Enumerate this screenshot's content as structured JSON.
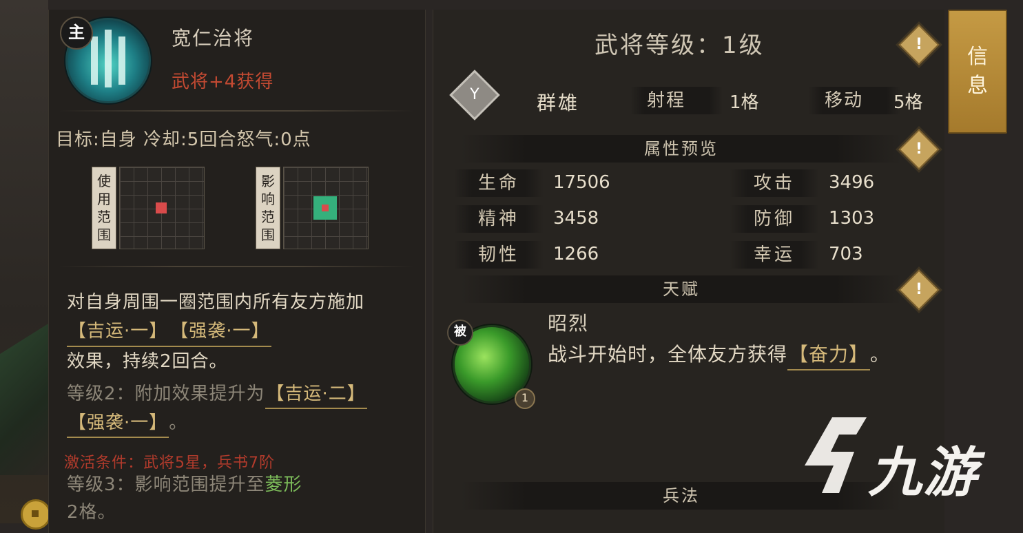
{
  "skill": {
    "badge": "主",
    "name": "宽仁治将",
    "type": "武将+4获得",
    "meta": "目标:自身 冷却:5回合怒气:0点",
    "use_range_label": [
      "使",
      "用",
      "范",
      "围"
    ],
    "effect_range_label": [
      "影",
      "响",
      "范",
      "围"
    ],
    "description": {
      "part1": "对自身周围一圈范围内所有友方施加",
      "tag1": "【吉运·一】",
      "tag2": "【强袭·一】",
      "part2": "效果，持续2回合。"
    },
    "level2": {
      "prefix": "等级2：附加效果提升为",
      "tag1": "【吉运·二】",
      "tag2": "【强袭·一】",
      "suffix": "。"
    },
    "condition": "激活条件：武将5星，兵书7阶",
    "level3": {
      "prefix": "等级3：影响范围提升至",
      "highlight": "菱形",
      "suffix": "2格。"
    }
  },
  "general": {
    "level_label": "武将等级：1级",
    "faction": "群雄",
    "faction_icon": "banner-icon",
    "range_label": "射程",
    "range_value": "1格",
    "move_label": "移动",
    "move_value": "5格"
  },
  "sections": {
    "attributes": "属性预览",
    "talent": "天赋",
    "tactics": "兵法"
  },
  "stats": [
    {
      "label": "生命",
      "value": "17506"
    },
    {
      "label": "攻击",
      "value": "3496"
    },
    {
      "label": "精神",
      "value": "3458"
    },
    {
      "label": "防御",
      "value": "1303"
    },
    {
      "label": "韧性",
      "value": "1266"
    },
    {
      "label": "幸运",
      "value": "703"
    }
  ],
  "talent": {
    "badge": "被",
    "level": "1",
    "name": "昭烈",
    "desc_prefix": "战斗开始时，全体友方获得",
    "desc_tag": "【奋力】",
    "desc_suffix": "。"
  },
  "info_tab": [
    "信",
    "息"
  ],
  "watermark": "九游",
  "colors": {
    "accent_gold": "#c59a44",
    "red_text": "#c44a32",
    "green_range": "#35b07c",
    "red_cell": "#d94b4b"
  }
}
